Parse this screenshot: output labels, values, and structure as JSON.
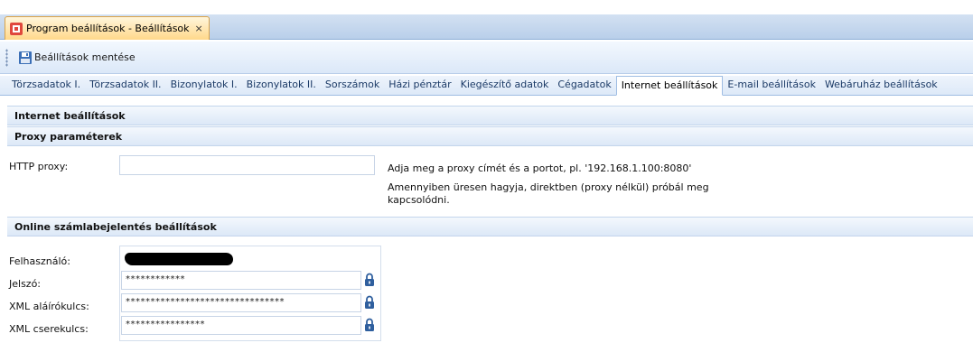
{
  "window": {
    "tab_title": "Program beállítások - Beállítások",
    "close_glyph": "×",
    "tab_icon": "settings-doc-icon"
  },
  "toolbar": {
    "save_label": "Beállítások mentése",
    "save_icon": "floppy-disk-icon"
  },
  "tabs": [
    {
      "label": "Törzsadatok I.",
      "active": false
    },
    {
      "label": "Törzsadatok II.",
      "active": false
    },
    {
      "label": "Bizonylatok I.",
      "active": false
    },
    {
      "label": "Bizonylatok II.",
      "active": false
    },
    {
      "label": "Sorszámok",
      "active": false
    },
    {
      "label": "Házi pénztár",
      "active": false
    },
    {
      "label": "Kiegészítő adatok",
      "active": false
    },
    {
      "label": "Cégadatok",
      "active": false
    },
    {
      "label": "Internet beállítások",
      "active": true
    },
    {
      "label": "E-mail beállítások",
      "active": false
    },
    {
      "label": "Webáruház beállítások",
      "active": false
    }
  ],
  "page": {
    "title": "Internet beállítások"
  },
  "proxy": {
    "section_title": "Proxy paraméterek",
    "label": "HTTP proxy:",
    "value": "",
    "hint_line1": "Adja meg a proxy címét és a portot, pl. '192.168.1.100:8080'",
    "hint_line2": "Amennyiben üresen hagyja, direktben (proxy nélkül) próbál meg",
    "hint_line3": "kapcsolódni."
  },
  "online": {
    "section_title": "Online számlabejelentés beállítások",
    "user_label": "Felhasználó:",
    "password_label": "Jelszó:",
    "password_value": "************",
    "sign_key_label": "XML aláírókulcs:",
    "sign_key_value": "********************************",
    "exchange_key_label": "XML cserekulcs:",
    "exchange_key_value": "****************",
    "lock_icon": "padlock-icon"
  },
  "colors": {
    "accent": "#3b6fb6",
    "tab_active": "#ffd88a",
    "lock": "#2f5f9e"
  }
}
